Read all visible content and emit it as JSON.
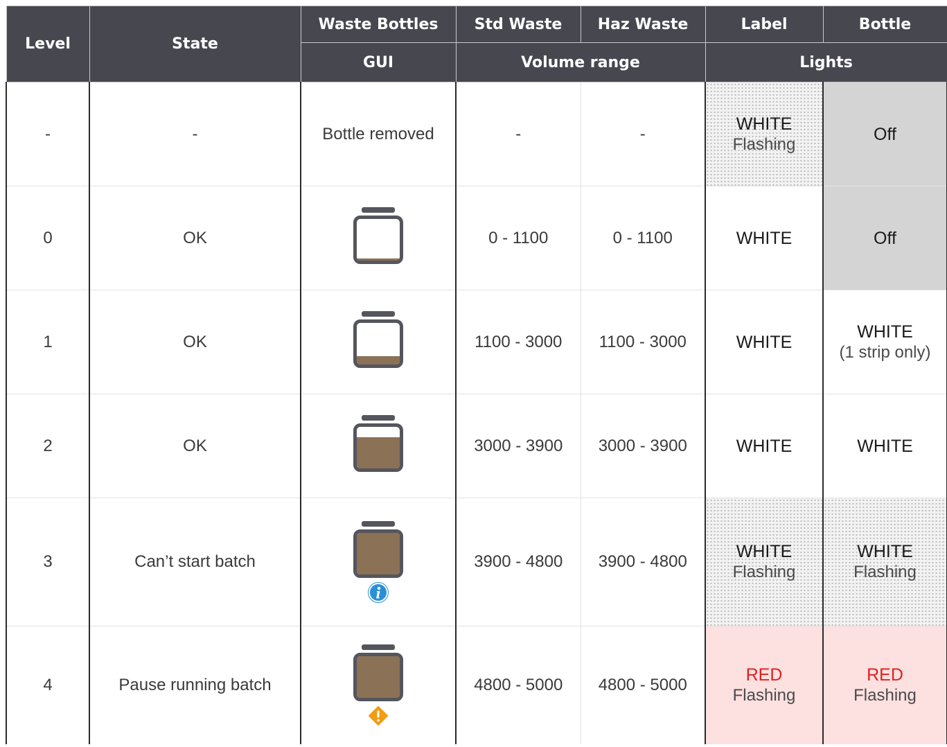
{
  "header": {
    "row1": [
      "Level",
      "State",
      "Waste Bottles",
      "Std Waste",
      "Haz Waste",
      "Label",
      "Bottle"
    ],
    "row2": {
      "gui": "GUI",
      "volume_range": "Volume range",
      "lights": "Lights"
    }
  },
  "rows": [
    {
      "level": "-",
      "state": "-",
      "gui_text": "Bottle removed",
      "std": "-",
      "haz": "-",
      "label_main": "WHITE",
      "label_sub": "Flashing",
      "bottle_main": "Off",
      "bottle_sub": ""
    },
    {
      "level": "0",
      "state": "OK",
      "fill_fraction": 0.05,
      "std": "0 - 1100",
      "haz": "0 - 1100",
      "label_main": "WHITE",
      "label_sub": "",
      "bottle_main": "Off",
      "bottle_sub": ""
    },
    {
      "level": "1",
      "state": "OK",
      "fill_fraction": 0.2,
      "std": "1100 - 3000",
      "haz": "1100 - 3000",
      "label_main": "WHITE",
      "label_sub": "",
      "bottle_main": "WHITE",
      "bottle_sub": "(1 strip only)"
    },
    {
      "level": "2",
      "state": "OK",
      "fill_fraction": 0.75,
      "std": "3000 - 3900",
      "haz": "3000 - 3900",
      "label_main": "WHITE",
      "label_sub": "",
      "bottle_main": "WHITE",
      "bottle_sub": ""
    },
    {
      "level": "3",
      "state": "Can’t start batch",
      "fill_fraction": 1.0,
      "badge": "info-icon",
      "std": "3900 - 4800",
      "haz": "3900 - 4800",
      "label_main": "WHITE",
      "label_sub": "Flashing",
      "bottle_main": "WHITE",
      "bottle_sub": "Flashing"
    },
    {
      "level": "4",
      "state": "Pause running batch",
      "fill_fraction": 1.0,
      "badge": "warning-icon",
      "std": "4800 - 5000",
      "haz": "4800 - 5000",
      "label_main": "RED",
      "label_sub": "Flashing",
      "bottle_main": "RED",
      "bottle_sub": "Flashing"
    }
  ],
  "colors": {
    "header_bg": "#474750",
    "bottle_outline": "#55565d",
    "waste_fill": "#8b7155",
    "red_light": "#e02020",
    "red_bg": "#fde0e0",
    "off_bg": "#d4d4d4",
    "info_badge": "#2a8fd8",
    "warning_badge": "#f39c12"
  }
}
